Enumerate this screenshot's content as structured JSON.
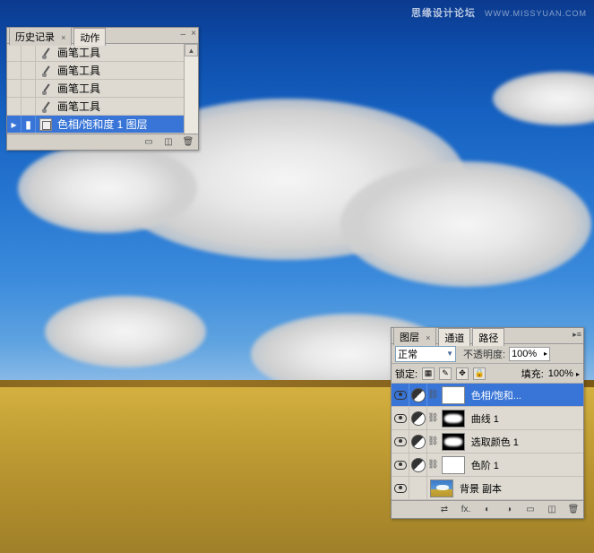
{
  "watermark": {
    "cn": "思缘设计论坛",
    "url": "WWW.MISSYUAN.COM"
  },
  "history_panel": {
    "tab_history": "历史记录",
    "tab_actions": "动作",
    "items": [
      {
        "label": "画笔工具",
        "icon": "brush"
      },
      {
        "label": "画笔工具",
        "icon": "brush"
      },
      {
        "label": "画笔工具",
        "icon": "brush"
      },
      {
        "label": "画笔工具",
        "icon": "brush"
      },
      {
        "label": "色相/饱和度 1 图层",
        "icon": "hue",
        "selected": true
      }
    ]
  },
  "layers_panel": {
    "tab_layers": "图层",
    "tab_channels": "通道",
    "tab_paths": "路径",
    "blend_mode": "正常",
    "opacity_label": "不透明度:",
    "opacity_value": "100%",
    "lock_label": "锁定:",
    "fill_label": "填充:",
    "fill_value": "100%",
    "layers": [
      {
        "label": "色相/饱和...",
        "type": "adj",
        "mask": "white",
        "selected": true,
        "linked": true
      },
      {
        "label": "曲线 1",
        "type": "adj",
        "mask": "cloud",
        "linked": true
      },
      {
        "label": "选取颜色 1",
        "type": "adj",
        "mask": "cloud",
        "linked": true
      },
      {
        "label": "色阶 1",
        "type": "adj",
        "mask": "white",
        "linked": true
      },
      {
        "label": "背景 副本",
        "type": "image",
        "linked": false
      }
    ],
    "footer_fx": "fx."
  }
}
